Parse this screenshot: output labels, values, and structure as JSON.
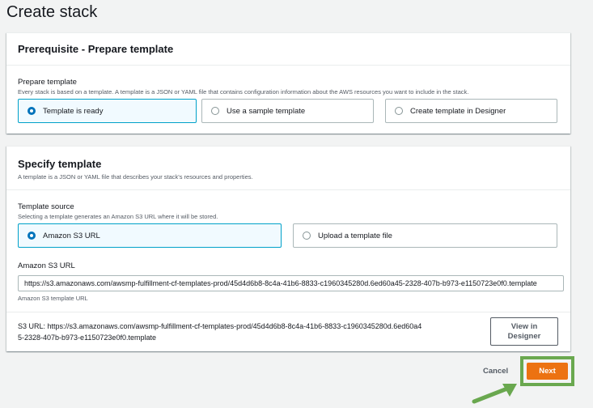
{
  "page": {
    "title": "Create stack"
  },
  "prerequisite": {
    "header": "Prerequisite - Prepare template",
    "label": "Prepare template",
    "description": "Every stack is based on a template. A template is a JSON or YAML file that contains configuration information about the AWS resources you want to include in the stack.",
    "options": [
      {
        "label": "Template is ready",
        "selected": true
      },
      {
        "label": "Use a sample template",
        "selected": false
      },
      {
        "label": "Create template in Designer",
        "selected": false
      }
    ]
  },
  "specify": {
    "header": "Specify template",
    "header_desc": "A template is a JSON or YAML file that describes your stack's resources and properties.",
    "source_label": "Template source",
    "source_desc": "Selecting a template generates an Amazon S3 URL where it will be stored.",
    "options": [
      {
        "label": "Amazon S3 URL",
        "selected": true
      },
      {
        "label": "Upload a template file",
        "selected": false
      }
    ],
    "url_label": "Amazon S3 URL",
    "url_value": "https://s3.amazonaws.com/awsmp-fulfillment-cf-templates-prod/45d4d6b8-8c4a-41b6-8833-c1960345280d.6ed60a45-2328-407b-b973-e1150723e0f0.template",
    "url_hint": "Amazon S3 template URL",
    "s3_url_line1": "S3 URL:  https://s3.amazonaws.com/awsmp-fulfillment-cf-templates-prod/45d4d6b8-8c4a-41b6-8833-c1960345280d.6ed60a4",
    "s3_url_line2": "5-2328-407b-b973-e1150723e0f0.template",
    "view_button": "View in Designer"
  },
  "footer": {
    "cancel": "Cancel",
    "next": "Next"
  },
  "colors": {
    "accent": "#ec7211",
    "selected_border": "#00a1c9",
    "highlight": "#6aa84f"
  },
  "icons": [
    "radio-selected-icon",
    "radio-unselected-icon",
    "arrow-pointer-icon"
  ]
}
